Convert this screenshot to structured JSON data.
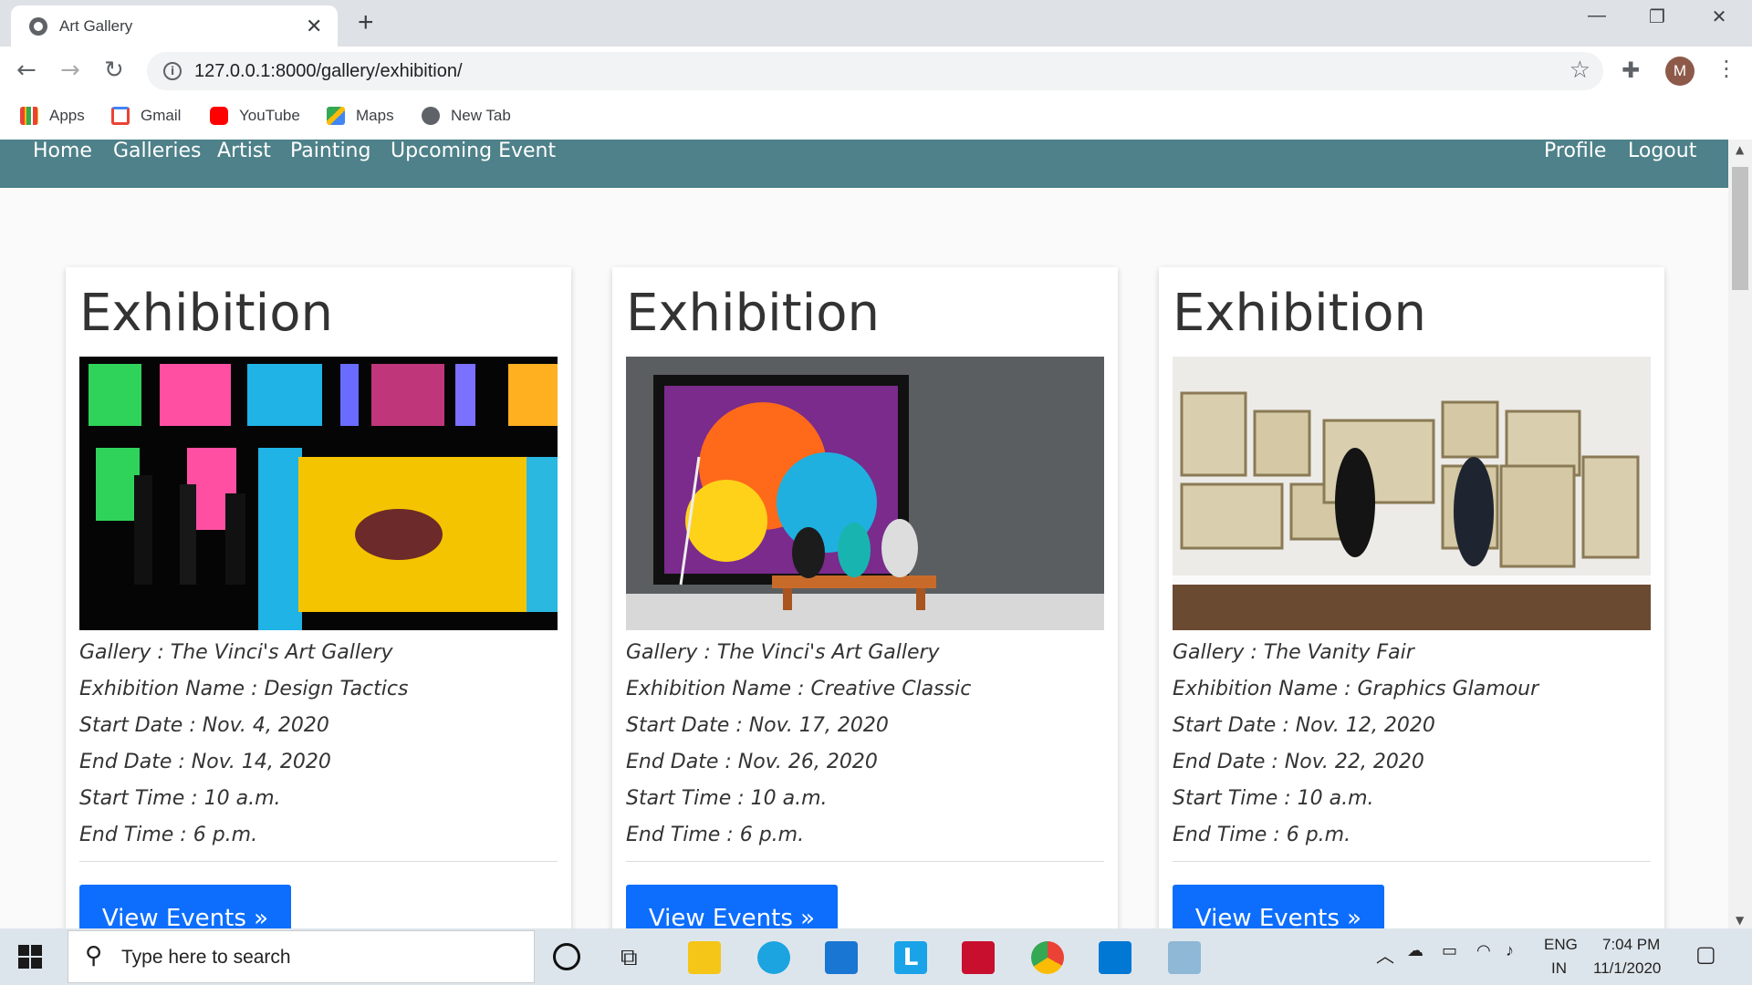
{
  "browser": {
    "tab_title": "Art Gallery",
    "url": "127.0.0.1:8000/gallery/exhibition/",
    "avatar_initial": "M",
    "bookmarks": [
      "Apps",
      "Gmail",
      "YouTube",
      "Maps",
      "New Tab"
    ]
  },
  "nav": {
    "left": [
      "Home",
      "Galleries",
      "Artist",
      "Painting",
      "Upcoming Event"
    ],
    "right": [
      "Profile",
      "Logout"
    ]
  },
  "cards": [
    {
      "title": "Exhibition",
      "gallery": "Gallery : The Vinci's Art Gallery",
      "name": "Exhibition Name : Design Tactics",
      "start_date": "Start Date : Nov. 4, 2020",
      "end_date": "End Date : Nov. 14, 2020",
      "start_time": "Start Time : 10 a.m.",
      "end_time": "End Time : 6 p.m.",
      "button": "View Events »"
    },
    {
      "title": "Exhibition",
      "gallery": "Gallery : The Vinci's Art Gallery",
      "name": "Exhibition Name : Creative Classic",
      "start_date": "Start Date : Nov. 17, 2020",
      "end_date": "End Date : Nov. 26, 2020",
      "start_time": "Start Time : 10 a.m.",
      "end_time": "End Time : 6 p.m.",
      "button": "View Events »"
    },
    {
      "title": "Exhibition",
      "gallery": "Gallery : The Vanity Fair",
      "name": "Exhibition Name : Graphics Glamour",
      "start_date": "Start Date : Nov. 12, 2020",
      "end_date": "End Date : Nov. 22, 2020",
      "start_time": "Start Time : 10 a.m.",
      "end_time": "End Time : 6 p.m.",
      "button": "View Events »"
    }
  ],
  "taskbar": {
    "search_placeholder": "Type here to search",
    "lang": "ENG",
    "region": "IN",
    "time": "7:04 PM",
    "date": "11/1/2020"
  },
  "colors": {
    "nav_bg": "#4e8189",
    "button_bg": "#0d6efd"
  }
}
